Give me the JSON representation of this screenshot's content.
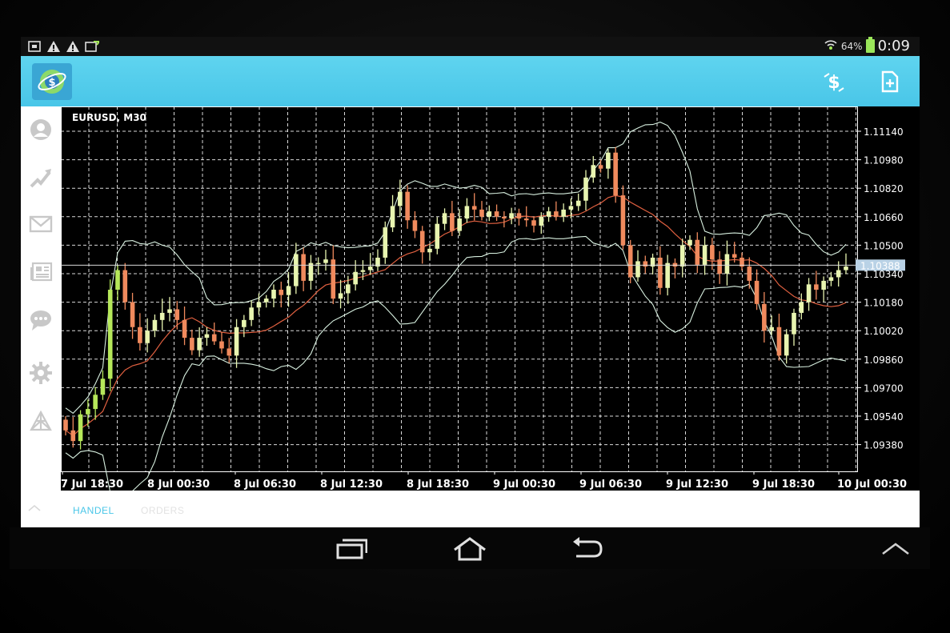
{
  "status_bar": {
    "icons": [
      "notification-box-icon",
      "warning-icon",
      "warning-icon",
      "download-icon"
    ],
    "battery_percent": "64%",
    "time": "0:09",
    "signal_icon": "wifi-signal-icon",
    "battery_icon": "battery-icon"
  },
  "action_bar": {
    "app_icon": "metatrader-logo-icon",
    "buttons": [
      {
        "name": "trade-currency-button",
        "icon": "dollar-exchange-icon"
      },
      {
        "name": "new-order-button",
        "icon": "document-plus-icon"
      }
    ]
  },
  "side_nav": {
    "items": [
      {
        "name": "nav-accounts",
        "icon": "avatar-icon"
      },
      {
        "name": "nav-trade",
        "icon": "trend-arrow-icon"
      },
      {
        "name": "nav-mailbox",
        "icon": "mail-icon"
      },
      {
        "name": "nav-news",
        "icon": "news-icon"
      },
      {
        "name": "nav-chat",
        "icon": "chat-icon"
      },
      {
        "name": "nav-settings",
        "icon": "gear-icon"
      },
      {
        "name": "nav-community",
        "icon": "network-icon"
      }
    ]
  },
  "chart": {
    "symbol_label": "EURUSD, M30",
    "current_price": "1.10388",
    "price_ticks": [
      "1.11140",
      "1.10980",
      "1.10820",
      "1.10660",
      "1.10500",
      "1.10340",
      "1.10180",
      "1.10020",
      "1.09860",
      "1.09700",
      "1.09540",
      "1.09380"
    ],
    "time_labels": [
      "7 Jul 18:30",
      "8 Jul 00:30",
      "8 Jul 06:30",
      "8 Jul 12:30",
      "8 Jul 18:30",
      "9 Jul 00:30",
      "9 Jul 06:30",
      "9 Jul 12:30",
      "9 Jul 18:30",
      "10 Jul 00:30"
    ],
    "colors": {
      "bull": "#e8f5b0",
      "bull_first": "#b6e85a",
      "bear": "#f08a5d",
      "grid": "#ffffff",
      "band": "#d8f0e0",
      "ma": "#e06040"
    }
  },
  "chart_data": {
    "type": "candlestick",
    "title": "EURUSD, M30",
    "ylim": [
      1.0928,
      1.1122
    ],
    "y_ticks": [
      1.1114,
      1.1098,
      1.1082,
      1.1066,
      1.105,
      1.1034,
      1.1018,
      1.1002,
      1.0986,
      1.097,
      1.0954,
      1.0938
    ],
    "x_labels": [
      "7 Jul 18:30",
      "8 Jul 00:30",
      "8 Jul 06:30",
      "8 Jul 12:30",
      "8 Jul 18:30",
      "9 Jul 00:30",
      "9 Jul 06:30",
      "9 Jul 12:30",
      "9 Jul 18:30",
      "10 Jul 00:30"
    ],
    "last_price": 1.10388,
    "grid": true,
    "closes": [
      1.0946,
      1.094,
      1.0955,
      1.0958,
      1.0966,
      1.0975,
      1.1025,
      1.1036,
      1.1018,
      1.1004,
      1.0995,
      1.1002,
      1.1008,
      1.1012,
      1.1014,
      1.1008,
      1.0998,
      1.0991,
      1.0998,
      1.1,
      1.0996,
      1.0992,
      1.0988,
      1.1004,
      1.1008,
      1.1015,
      1.1018,
      1.102,
      1.1025,
      1.1022,
      1.1027,
      1.1045,
      1.103,
      1.104,
      1.104,
      1.1042,
      1.102,
      1.1023,
      1.1028,
      1.1035,
      1.1036,
      1.1038,
      1.1043,
      1.106,
      1.1072,
      1.108,
      1.1064,
      1.1058,
      1.1046,
      1.1048,
      1.1062,
      1.1068,
      1.1058,
      1.1065,
      1.1072,
      1.107,
      1.1066,
      1.1069,
      1.1066,
      1.1065,
      1.1068,
      1.1065,
      1.1064,
      1.1061,
      1.1066,
      1.1069,
      1.1066,
      1.107,
      1.1072,
      1.1075,
      1.1088,
      1.1095,
      1.1093,
      1.1102,
      1.1078,
      1.105,
      1.1032,
      1.1041,
      1.1038,
      1.1043,
      1.1026,
      1.104,
      1.1038,
      1.105,
      1.1053,
      1.1039,
      1.105,
      1.1042,
      1.1034,
      1.1045,
      1.1043,
      1.1038,
      1.103,
      1.1017,
      1.1002,
      1.1004,
      1.0988,
      1.1,
      1.1012,
      1.1018,
      1.1028,
      1.1025,
      1.103,
      1.1032,
      1.1036,
      1.1038
    ]
  },
  "bottom_tabs": {
    "active": "HANDEL",
    "inactive": "ORDERS",
    "up_icon": "chevron-up-icon"
  },
  "system_nav": {
    "recents": "recent-apps-icon",
    "home": "home-icon",
    "back": "back-icon",
    "menu": "chevron-up-icon"
  }
}
